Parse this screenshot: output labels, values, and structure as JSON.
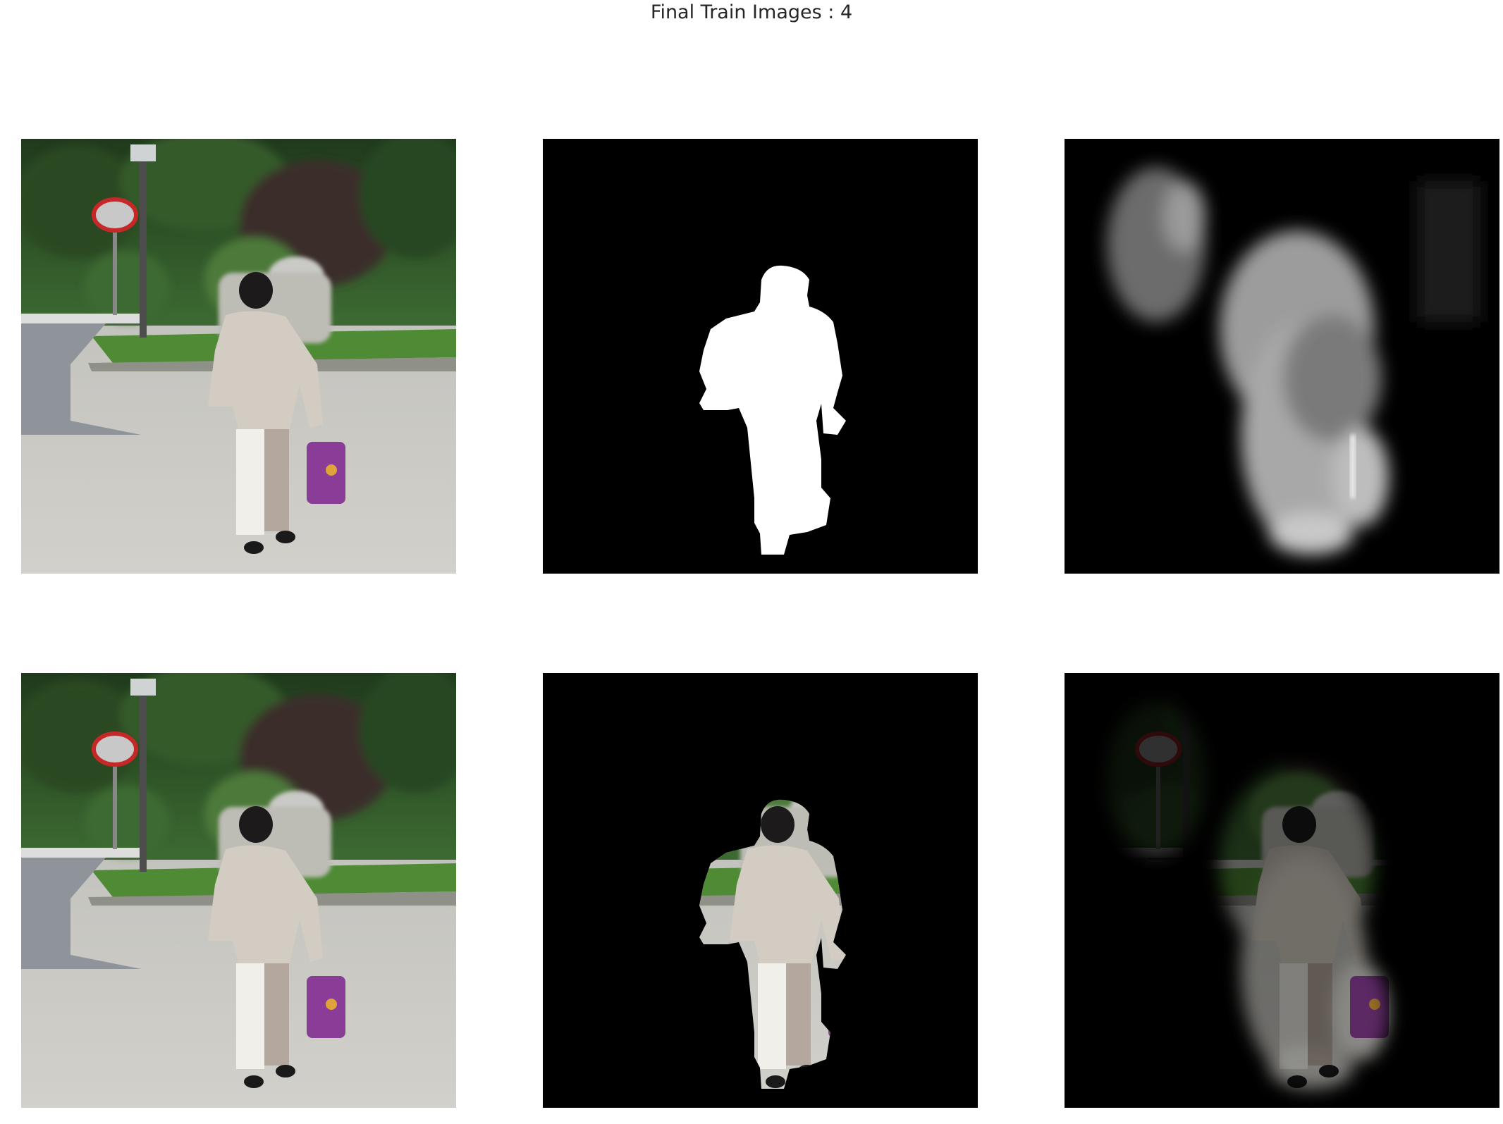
{
  "figure": {
    "title": "Final Train Images : 4"
  },
  "panels": [
    {
      "row": 0,
      "col": 0,
      "content": "input-photo",
      "shows": "person walking on road carrying purple bag"
    },
    {
      "row": 0,
      "col": 1,
      "content": "ground-truth-mask"
    },
    {
      "row": 0,
      "col": 2,
      "content": "predicted-mask"
    },
    {
      "row": 1,
      "col": 0,
      "content": "input-photo"
    },
    {
      "row": 1,
      "col": 1,
      "content": "masked-ground-truth"
    },
    {
      "row": 1,
      "col": 2,
      "content": "masked-prediction"
    }
  ]
}
